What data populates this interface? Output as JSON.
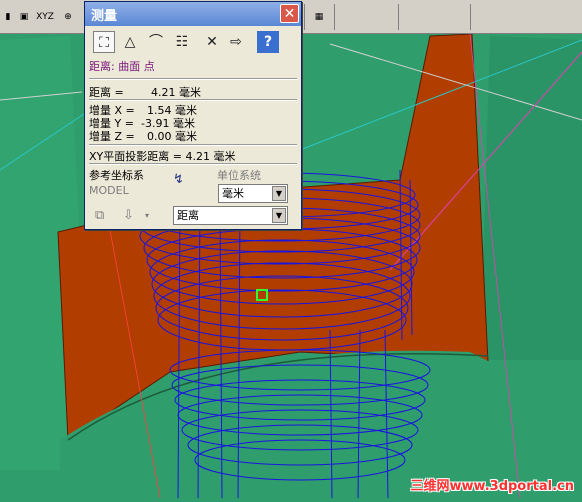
{
  "toolbar": {
    "xyz_label": "XYZ"
  },
  "dialog": {
    "title": "测量",
    "close_glyph": "✕",
    "help_glyph": "?",
    "mode_label": "距离: 曲面 点",
    "distance_label": "距离 =",
    "distance_value": "4.21 毫米",
    "delta_x_label": "增量 X =",
    "delta_x_value": "1.54 毫米",
    "delta_y_label": "增量 Y =",
    "delta_y_value": "-3.91 毫米",
    "delta_z_label": "增量 Z =",
    "delta_z_value": "0.00 毫米",
    "xy_projection": "XY平面投影距离 = 4.21 毫米",
    "ref_csys_label": "参考坐标系",
    "ref_csys_value": "MODEL",
    "unit_system_label": "单位系统",
    "unit_select_value": "毫米",
    "type_select_value": "距离"
  },
  "watermark": "三维网www.3dportal.cn",
  "colors": {
    "background_green": "#2f9e6c",
    "surface_red": "#b13e00",
    "toolpath_blue": "#1a14e0",
    "title_blue": "#5a87d4"
  }
}
